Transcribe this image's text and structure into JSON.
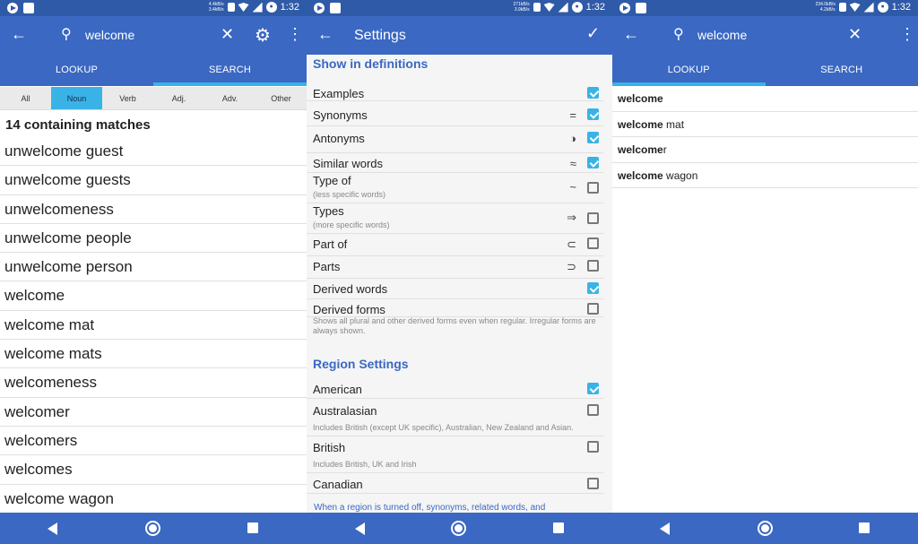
{
  "status": {
    "time": "1:32",
    "net1": "4.4kB/s 3.4kB/s",
    "net2": "271kB/s 3.9kB/s",
    "net3": "234.0kB/s 4.2kB/s"
  },
  "panel1": {
    "search_value": "welcome",
    "tabs": [
      "LOOKUP",
      "SEARCH"
    ],
    "filters": [
      "All",
      "Noun",
      "Verb",
      "Adj.",
      "Adv.",
      "Other"
    ],
    "count": "14 containing matches",
    "words": [
      "unwelcome guest",
      "unwelcome guests",
      "unwelcomeness",
      "unwelcome people",
      "unwelcome person",
      "welcome",
      "welcome mat",
      "welcome mats",
      "welcomeness",
      "welcomer",
      "welcomers",
      "welcomes",
      "welcome wagon"
    ]
  },
  "panel2": {
    "title": "Settings",
    "section1": "Show in definitions",
    "rows": [
      {
        "label": "Examples",
        "sym": "",
        "checked": true
      },
      {
        "label": "Synonyms",
        "sym": "=",
        "checked": true
      },
      {
        "label": "Antonyms",
        "sym": "◑",
        "checked": true
      },
      {
        "label": "Similar words",
        "sym": "≈",
        "checked": true
      },
      {
        "label": "Type of",
        "sub": "(less specific words)",
        "sym": "~",
        "checked": false
      },
      {
        "label": "Types",
        "sub": "(more specific words)",
        "sym": "⇒",
        "checked": false
      },
      {
        "label": "Part of",
        "sym": "⊂",
        "checked": false
      },
      {
        "label": "Parts",
        "sym": "⊃",
        "checked": false
      },
      {
        "label": "Derived words",
        "sym": "",
        "checked": true
      },
      {
        "label": "Derived forms",
        "sym": "",
        "checked": false
      }
    ],
    "derived_note": "Shows all plural and other derived forms even when regular. Irregular forms are always shown.",
    "section2": "Region Settings",
    "regions": [
      {
        "label": "American",
        "checked": true,
        "note": ""
      },
      {
        "label": "Australasian",
        "checked": false,
        "note": "Includes British (except UK specific), Australian, New Zealand and Asian."
      },
      {
        "label": "British",
        "checked": false,
        "note": "Includes British, UK and Irish"
      },
      {
        "label": "Canadian",
        "checked": false,
        "note": ""
      }
    ],
    "footer_note": "When a region is turned off, synonyms, related words, and"
  },
  "panel3": {
    "search_value": "welcome",
    "tabs": [
      "LOOKUP",
      "SEARCH"
    ],
    "results": [
      {
        "bold": "welcome",
        "rest": ""
      },
      {
        "bold": "welcome",
        "rest": " mat"
      },
      {
        "bold": "welcome",
        "rest": "r"
      },
      {
        "bold": "welcome",
        "rest": " wagon"
      }
    ]
  }
}
